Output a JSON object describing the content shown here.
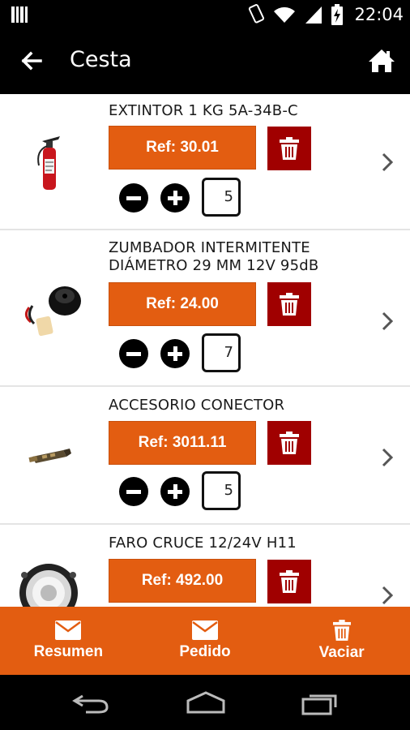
{
  "status_bar": {
    "time": "22:04"
  },
  "app_bar": {
    "title": "Cesta"
  },
  "items": [
    {
      "name": "EXTINTOR 1 KG 5A-34B-C",
      "ref": "Ref: 30.01",
      "quantity": "5"
    },
    {
      "name": "ZUMBADOR INTERMITENTE DIÁMETRO 29 MM 12V 95dB",
      "ref": "Ref: 24.00",
      "quantity": "7"
    },
    {
      "name": "ACCESORIO CONECTOR",
      "ref": "Ref: 3011.11",
      "quantity": "5"
    },
    {
      "name": "FARO CRUCE 12/24V H11",
      "ref": "Ref: 492.00",
      "quantity": ""
    }
  ],
  "bottom_bar": {
    "resumen": "Resumen",
    "pedido": "Pedido",
    "vaciar": "Vaciar"
  },
  "colors": {
    "accent": "#e35d11",
    "trash": "#a00000"
  }
}
